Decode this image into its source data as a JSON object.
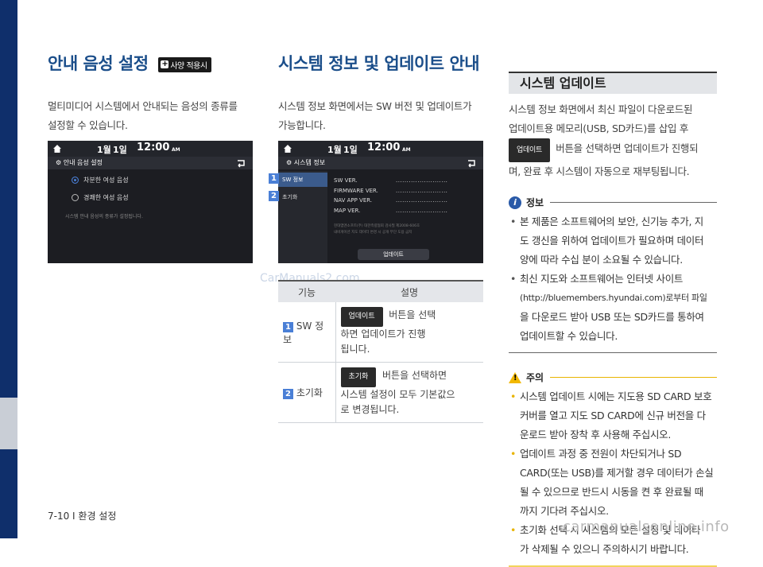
{
  "left": {
    "title": "안내 음성 설정",
    "badge": "사양 적용시",
    "body": [
      "멀티미디어 시스템에서 안내되는 음성의 종류를",
      "설정할 수 있습니다."
    ],
    "screen": {
      "date_month": "1월",
      "date_day": "1일",
      "time": "12:00",
      "ampm": "AM",
      "title": "안내 음성 설정",
      "options": [
        "차분한 여성 음성",
        "경쾌한 여성 음성"
      ],
      "note": "시스템 안내 음성의 종류가 설정됩니다."
    }
  },
  "middle": {
    "title": "시스템 정보 및 업데이트 안내",
    "body": [
      "시스템 정보 화면에서는 SW 버전 및 업데이트가",
      "가능합니다."
    ],
    "screen": {
      "date_month": "1월",
      "date_day": "1일",
      "time": "12:00",
      "ampm": "AM",
      "title": "시스템 정보",
      "menu": [
        "SW 정보",
        "초기화"
      ],
      "markers": [
        "1",
        "2"
      ],
      "rows": [
        "SW VER.",
        "FIRMWARE VER.",
        "NAV APP VER.",
        "MAP VER."
      ],
      "dots": "........................",
      "fine_print": [
        "현대엠엔소프트(주)  대한측량협회 검사필 제2008-606호",
        "내비게이션 지도 데이터 변경 시 공개 무단 도용 금지"
      ],
      "update_btn": "업데이트"
    },
    "table": {
      "headers": [
        "기능",
        "설명"
      ],
      "rows": [
        {
          "marker": "1",
          "name": "SW 정보",
          "btn": "업데이트",
          "desc_a": "버튼을 선택",
          "desc_b": "하면 업데이트가 진행",
          "desc_c": "됩니다."
        },
        {
          "marker": "2",
          "name": "초기화",
          "btn": "초기화",
          "desc_a": "버튼을 선택하면",
          "desc_b": "시스템 설정이 모두 기본값으",
          "desc_c": "로 변경됩니다."
        }
      ]
    },
    "watermark": "CarManuals2.com"
  },
  "right": {
    "box_title": "시스템 업데이트",
    "body1": "시스템 정보 화면에서 최신 파일이 다운로드된",
    "body2": "업데이트용 메모리(USB, SD카드)를 삽입 후",
    "inline_btn": "업데이트",
    "body3": "버튼을 선택하면 업데이트가 진행되",
    "body4": "며, 완료 후 시스템이 자동으로 재부팅됩니다.",
    "info": {
      "label": "정보",
      "icon": "i",
      "items": [
        [
          "본 제품은 소프트웨어의 보안, 신기능 추가, 지",
          "도 갱신을 위하여 업데이트가 필요하며 데이터",
          "양에 따라 수십 분이 소요될 수 있습니다."
        ],
        [
          "최신 지도와 소프트웨어는 인터넷 사이트",
          "(http://bluemembers.hyundai.com)로부터 파일",
          "을 다운로드 받아 USB 또는 SD카드를 통하여",
          "업데이트할 수 있습니다."
        ]
      ]
    },
    "caution": {
      "label": "주의",
      "icon": "!",
      "items": [
        [
          "시스템 업데이트 시에는 지도용 SD CARD 보호",
          "커버를 열고 지도 SD CARD에 신규 버전을 다",
          "운로드 받아 장착 후 사용해 주십시오."
        ],
        [
          "업데이트 과정 중 전원이 차단되거나 SD",
          "CARD(또는 USB)를 제거할 경우 데이터가 손실",
          "될 수 있으므로 반드시 시동을 켠 후 완료될 때",
          "까지 기다려 주십시오."
        ],
        [
          "초기화 선택 시 시스템의 모든 설정 및 데이타",
          "가 삭제될 수 있으니 주의하시기 바랍니다."
        ]
      ]
    }
  },
  "footer": "7-10 I 환경 설정",
  "bottom_watermark": "carmanualsonline.info"
}
